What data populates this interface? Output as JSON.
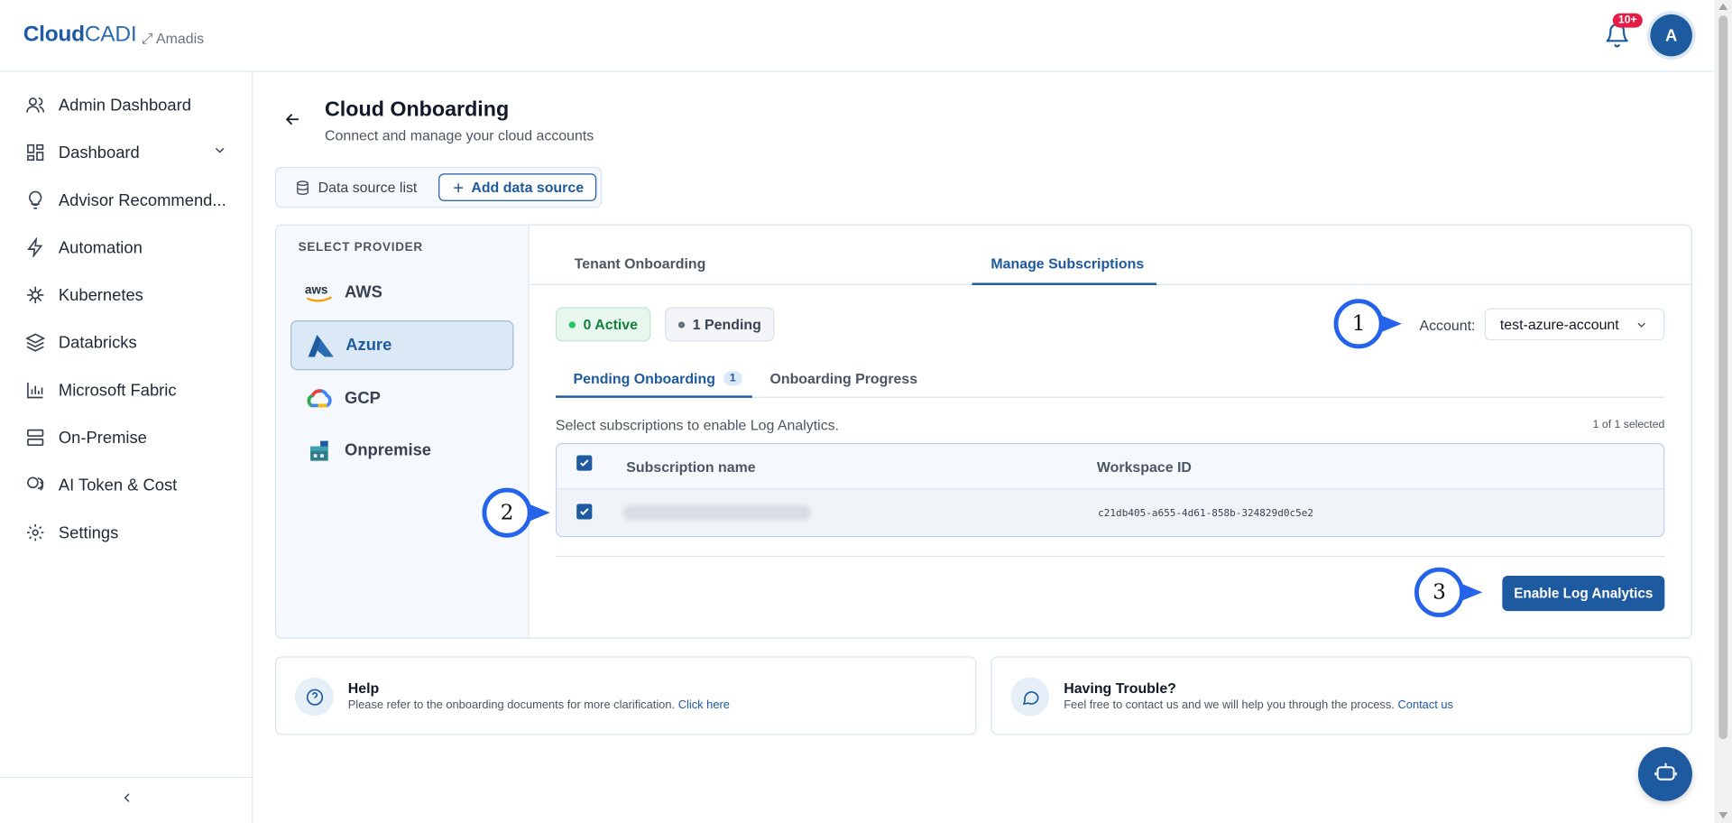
{
  "header": {
    "brand_bold": "Cloud",
    "brand_light": "CADI",
    "tenant": "⤢ Amadis",
    "notification_count": "10+",
    "avatar_initial": "A"
  },
  "sidebar": {
    "items": [
      {
        "label": "Admin Dashboard",
        "icon": "users-icon"
      },
      {
        "label": "Dashboard",
        "icon": "dashboard-icon"
      },
      {
        "label": "Advisor Recommend...",
        "icon": "lightbulb-icon"
      },
      {
        "label": "Automation",
        "icon": "bolt-icon"
      },
      {
        "label": "Kubernetes",
        "icon": "helm-icon"
      },
      {
        "label": "Databricks",
        "icon": "layers-icon"
      },
      {
        "label": "Microsoft Fabric",
        "icon": "bar-chart-icon"
      },
      {
        "label": "On-Premise",
        "icon": "server-icon"
      },
      {
        "label": "AI Token & Cost",
        "icon": "coins-icon"
      },
      {
        "label": "Settings",
        "icon": "gear-icon"
      }
    ]
  },
  "page": {
    "title": "Cloud Onboarding",
    "subtitle": "Connect and manage your cloud accounts",
    "ds_tab_list": "Data source list",
    "ds_tab_add": "Add data source"
  },
  "providers": {
    "title": "SELECT PROVIDER",
    "items": [
      "AWS",
      "Azure",
      "GCP",
      "Onpremise"
    ],
    "aws_logo_text": "aws"
  },
  "tabs": {
    "tenant": "Tenant Onboarding",
    "manage": "Manage Subscriptions"
  },
  "status": {
    "active": "0 Active",
    "pending": "1 Pending"
  },
  "account": {
    "label": "Account:",
    "value": "test-azure-account"
  },
  "subtabs": {
    "pending": "Pending Onboarding",
    "pending_count": "1",
    "progress": "Onboarding Progress"
  },
  "table": {
    "hint": "Select subscriptions to enable Log Analytics.",
    "selected_count": "1 of 1 selected",
    "col_name": "Subscription name",
    "col_workspace": "Workspace ID",
    "rows": [
      {
        "workspace_id": "c21db405-a655-4d61-858b-324829d0c5e2"
      }
    ]
  },
  "enable_button": "Enable Log Analytics",
  "help": {
    "title": "Help",
    "desc": "Please refer to the onboarding documents for more clarification.",
    "link": "Click here"
  },
  "trouble": {
    "title": "Having Trouble?",
    "desc": "Feel free to contact us and we will help you through the process.",
    "link": "Contact us"
  },
  "markers": [
    "1",
    "2",
    "3"
  ],
  "colors": {
    "primary": "#1e5aa0",
    "active_green": "#15803d",
    "badge_red": "#e11d48",
    "marker_blue": "#2563eb"
  }
}
